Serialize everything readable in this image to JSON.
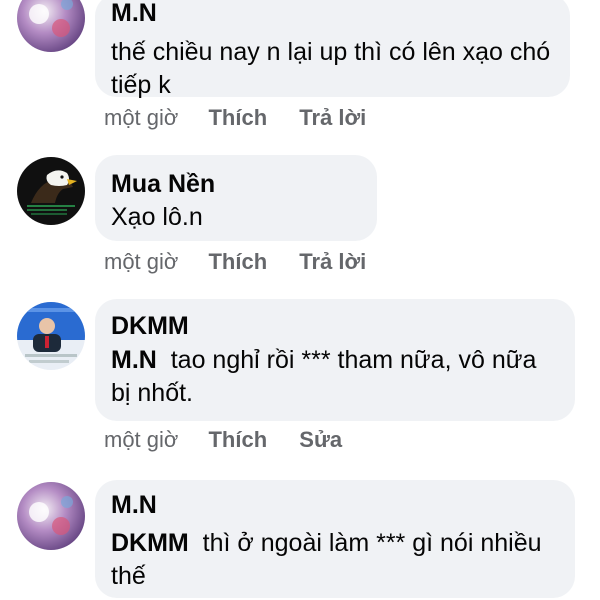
{
  "comments": [
    {
      "author": "M.N",
      "text": "thế chiều nay n lại up thì có lên xạo chó tiếp k",
      "actions": {
        "time": "một giờ",
        "like": "Thích",
        "reply": "Trả lời"
      }
    },
    {
      "author": "Mua Nền",
      "text": "Xạo lô.n",
      "actions": {
        "time": "một giờ",
        "like": "Thích",
        "reply": "Trả lời"
      }
    },
    {
      "author": "DKMM",
      "mention": "M.N",
      "text": "tao nghỉ rồi *** tham nữa, vô nữa bị nhốt.",
      "actions": {
        "time": "một giờ",
        "like": "Thích",
        "reply": "Sửa"
      }
    },
    {
      "author": "M.N",
      "mention": "DKMM",
      "text": "thì ở ngoài làm *** gì nói nhiều thế"
    }
  ],
  "colors": {
    "bubble": "#f0f2f5",
    "meta_text": "#65676b",
    "text": "#050505"
  },
  "icons": [
    "avatar-mn",
    "avatar-eagle",
    "avatar-news-person"
  ]
}
